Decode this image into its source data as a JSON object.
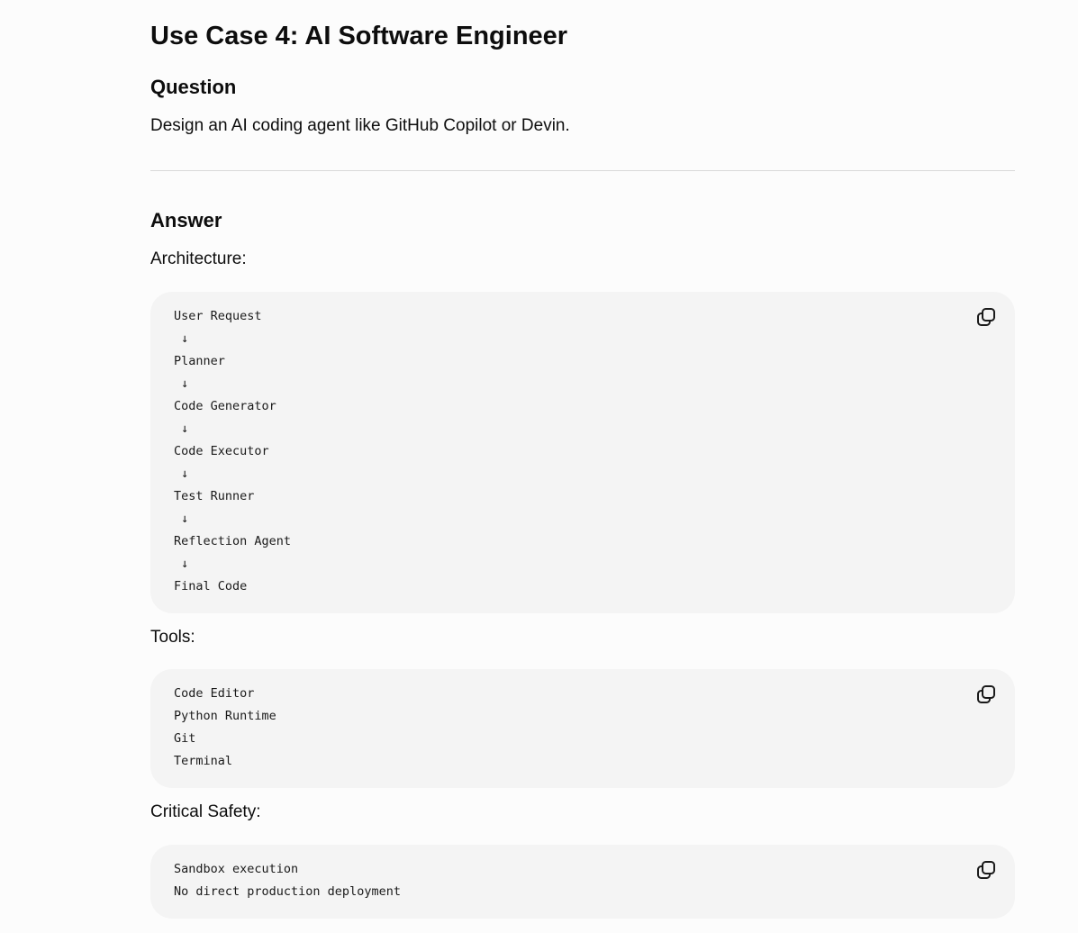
{
  "page": {
    "title": "Use Case 4: AI Software Engineer"
  },
  "question": {
    "heading": "Question",
    "text": "Design an AI coding agent like GitHub Copilot or Devin."
  },
  "answer": {
    "heading": "Answer",
    "architecture_label": "Architecture:",
    "architecture_code": "User Request\n ↓\nPlanner\n ↓\nCode Generator\n ↓\nCode Executor\n ↓\nTest Runner\n ↓\nReflection Agent\n ↓\nFinal Code",
    "tools_label": "Tools:",
    "tools_code": "Code Editor\nPython Runtime\nGit\nTerminal",
    "safety_label": "Critical Safety:",
    "safety_code": "Sandbox execution\nNo direct production deployment"
  },
  "icons": {
    "copy": "copy-icon"
  }
}
